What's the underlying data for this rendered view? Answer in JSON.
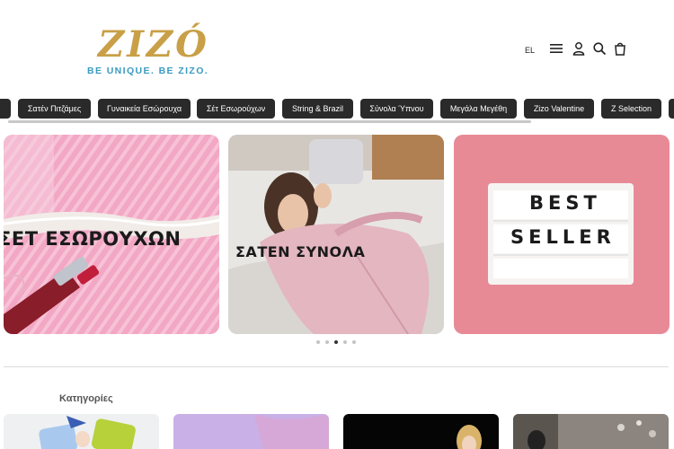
{
  "brand": {
    "name": "ZIZÓ",
    "tagline": "BE UNIQUE. BE ZIZO.",
    "gold": "#c9a047",
    "blue": "#3a9bc0"
  },
  "header": {
    "language": "EL",
    "icons": [
      "menu-icon",
      "user-icon",
      "search-icon",
      "cart-icon"
    ]
  },
  "chips": [
    "Σατέν Πιτζάμες",
    "Γυναικεία Εσώρουχα",
    "Σέτ Εσωρούχων",
    "String & Brazil",
    "Σύνολα Ύπνου",
    "Μεγάλα Μεγέθη",
    "Zizo Valentine",
    "Z Selection"
  ],
  "slider": {
    "slides": [
      {
        "title": "ΣΕΤ ΕΣΩΡΟΥΧΩΝ"
      },
      {
        "title": "ΣΑΤΕΝ ΣΥΝΟΛΑ"
      },
      {
        "title": "",
        "lightbox_lines": [
          "BEST",
          "SELLER"
        ]
      }
    ],
    "dot_count": 5,
    "active_dot": 2
  },
  "categories": {
    "heading": "Κατηγορίες"
  }
}
